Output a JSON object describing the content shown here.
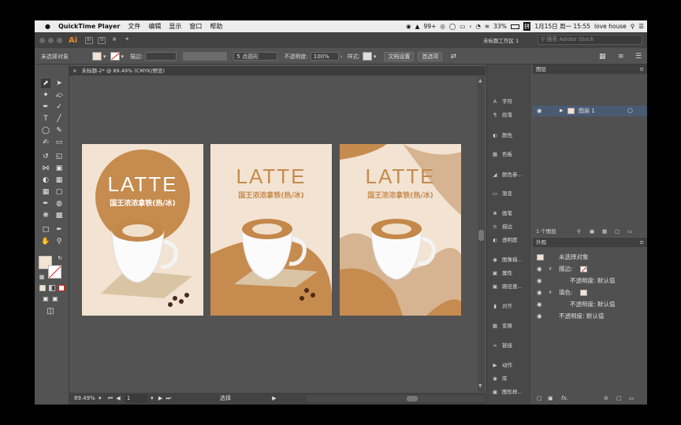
{
  "menubar": {
    "app": "QuickTime Player",
    "items": [
      "文件",
      "编辑",
      "显示",
      "窗口",
      "帮助"
    ],
    "badge": "99+",
    "battery": "33%",
    "datetime": "1月15日 周一 15:55",
    "user": "love house"
  },
  "appbar": {
    "logo": "Ai",
    "br": "Br",
    "st": "St",
    "workspace": "未标题工作区 1",
    "search_placeholder": "搜索 Adobe Stock"
  },
  "control": {
    "selection": "未选择对象",
    "stroke_label": "描边:",
    "brush": "5 点圆形",
    "opacity_label": "不透明度:",
    "opacity_value": "100%",
    "style_label": "样式:",
    "doc_setup": "文档设置",
    "preferences": "首选项"
  },
  "tab": {
    "title": "未标题-2* @ 89.49% (CMYK/预览)"
  },
  "artboards": [
    {
      "title": "LATTE",
      "subtitle": "国王浓浓拿铁(热/冰)"
    },
    {
      "title": "LATTE",
      "subtitle": "国王浓浓拿铁(热/冰)"
    },
    {
      "title": "LATTE",
      "subtitle": "国王浓浓拿铁(热/冰)"
    }
  ],
  "status": {
    "zoom": "89.49%",
    "page": "1",
    "tool": "选择"
  },
  "dock": [
    "字符",
    "段落",
    "颜色",
    "色板",
    "颜色参...",
    "渐变",
    "画笔",
    "描边",
    "透明度",
    "图像描...",
    "属性",
    "路径查...",
    "对齐",
    "变换",
    "链接",
    "动作",
    "库",
    "图形样..."
  ],
  "layers": {
    "tab": "图层",
    "layer_name": "图层 1",
    "count": "1 个图层"
  },
  "appearance": {
    "tab": "外观",
    "title": "未选择对象",
    "stroke": "描边:",
    "stroke_opacity": "不透明度: 默认值",
    "fill": "填色:",
    "fill_opacity": "不透明度: 默认值",
    "opacity": "不透明度: 默认值",
    "fx": "fx."
  },
  "colors": {
    "accent": "#c68b4e",
    "cream": "#f2e3d2",
    "brown": "#b8844d",
    "tan": "#d6b491"
  }
}
